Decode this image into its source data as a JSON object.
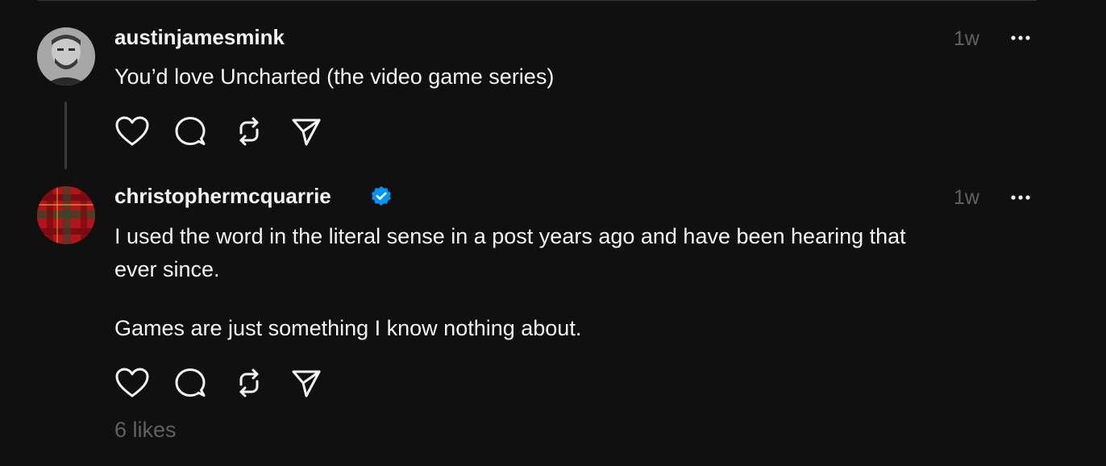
{
  "posts": [
    {
      "username": "austinjamesmink",
      "verified": false,
      "time": "1w",
      "body": [
        "You’d love Uncharted (the video game series)"
      ]
    },
    {
      "username": "christophermcquarrie",
      "verified": true,
      "time": "1w",
      "body": [
        "I used the word in the literal sense in a post years ago and have been hearing that",
        "ever since.",
        "Games are just something I know nothing about."
      ],
      "likes": "6 likes"
    }
  ],
  "icons": {
    "like": "heart-icon",
    "reply": "comment-icon",
    "repost": "repost-icon",
    "share": "send-icon",
    "more": "more-horizontal-icon",
    "verified": "verified-badge-icon"
  },
  "colors": {
    "background": "#101010",
    "text": "#f3f5f7",
    "secondary": "#616161",
    "verified": "#0095f6"
  }
}
